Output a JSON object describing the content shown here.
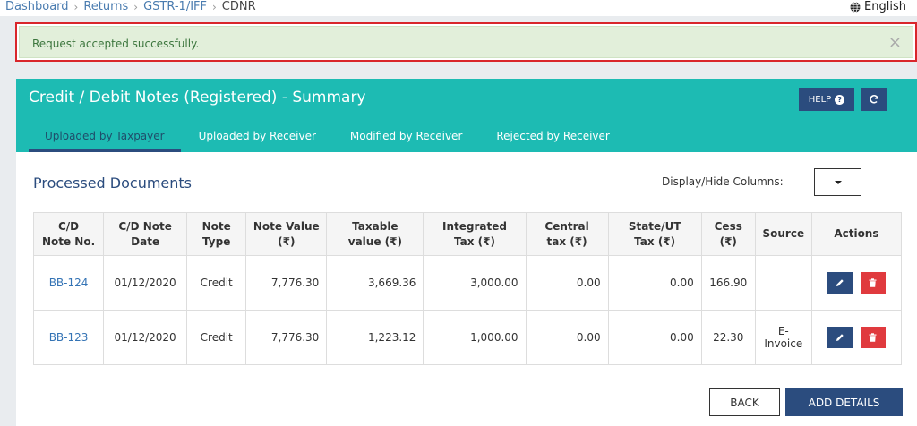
{
  "breadcrumb": [
    "Dashboard",
    "Returns",
    "GSTR-1/IFF",
    "CDNR"
  ],
  "language": "English",
  "alert": {
    "message": "Request accepted successfully.",
    "close": "×"
  },
  "panel": {
    "title": "Credit / Debit Notes (Registered) - Summary",
    "help_label": "HELP",
    "tabs": [
      "Uploaded by Taxpayer",
      "Uploaded by Receiver",
      "Modified by Receiver",
      "Rejected by Receiver"
    ],
    "active_tab": "Uploaded by Taxpayer"
  },
  "section": {
    "title": "Processed Documents",
    "display_hide_label": "Display/Hide Columns:"
  },
  "table": {
    "headers": [
      [
        "C/D",
        "Note No."
      ],
      [
        "C/D Note",
        "Date"
      ],
      [
        "Note",
        "Type"
      ],
      [
        "Note Value",
        "(₹)"
      ],
      [
        "Taxable",
        "value (₹)"
      ],
      [
        "Integrated",
        "Tax (₹)"
      ],
      [
        "Central",
        "tax (₹)"
      ],
      [
        "State/UT",
        "Tax (₹)"
      ],
      [
        "Cess",
        "(₹)"
      ],
      [
        "Source",
        ""
      ],
      [
        "Actions",
        ""
      ]
    ],
    "rows": [
      {
        "note_no": "BB-124",
        "date": "01/12/2020",
        "type": "Credit",
        "note_value": "7,776.30",
        "taxable": "3,669.36",
        "igst": "3,000.00",
        "cgst": "0.00",
        "sgst": "0.00",
        "cess": "166.90",
        "source": [
          "",
          ""
        ]
      },
      {
        "note_no": "BB-123",
        "date": "01/12/2020",
        "type": "Credit",
        "note_value": "7,776.30",
        "taxable": "1,223.12",
        "igst": "1,000.00",
        "cgst": "0.00",
        "sgst": "0.00",
        "cess": "22.30",
        "source": [
          "E-",
          "Invoice"
        ]
      }
    ]
  },
  "buttons": {
    "back": "BACK",
    "add_details": "ADD DETAILS"
  },
  "colors": {
    "teal": "#1dbbb3",
    "navy": "#2b4c7e",
    "danger": "#e03a3e",
    "success_bg": "#e2efda",
    "link": "#3574b5"
  }
}
